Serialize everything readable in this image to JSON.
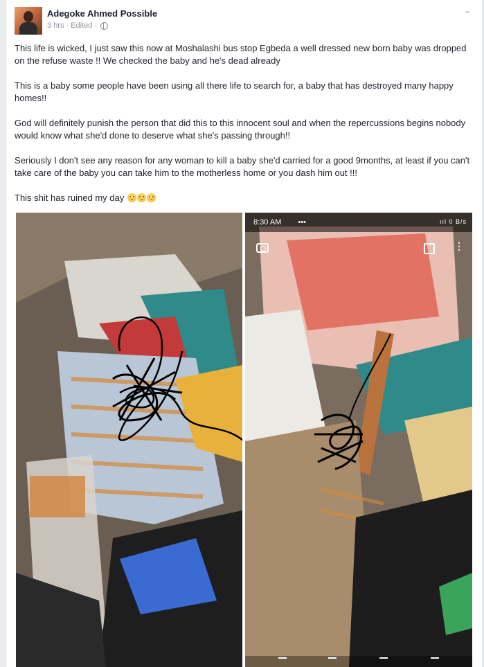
{
  "post": {
    "author": "Adegoke Ahmed Possible",
    "time": "3 hrs",
    "edited": "Edited",
    "separator": "·",
    "paragraphs": [
      "This life is wicked, I just saw this now at Moshalashi bus stop Egbeda a well dressed new born baby was dropped on the refuse waste !! We checked the baby and he's dead already",
      "This is a baby some people have been using all there life to search for, a baby that has  destroyed many happy homes!!",
      "God will definitely punish the person that did this to this innocent soul and when the repercussions begins nobody would know what she'd done to deserve what she's passing through!!",
      "Seriously I don't see any reason for any  woman to kill a baby she'd carried for a good 9months, at least if you can't take care of the baby you can take him to the motherless home or you dash him out !!!"
    ],
    "last_line": "This shit has ruined my day",
    "emoji_count": 3
  },
  "photos": {
    "right_status_time": "8:30 AM",
    "right_status_icons": "ııl 0 B/s",
    "right_status_extra": "•••"
  },
  "icons": {
    "menu": "chevron-down-icon",
    "privacy": "globe-icon",
    "camera": "camera-icon",
    "gallery": "gallery-icon",
    "more": "more-vert-icon"
  }
}
